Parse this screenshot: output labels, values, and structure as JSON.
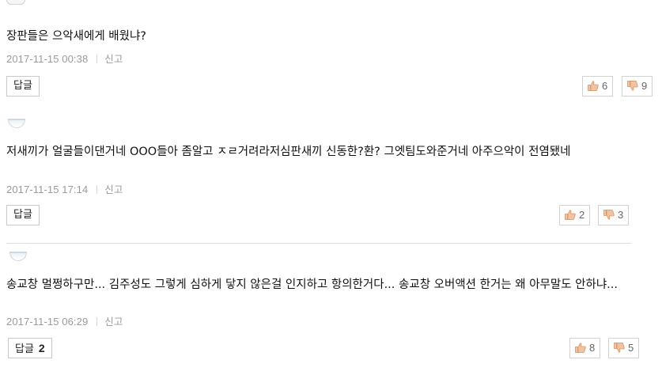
{
  "comments": [
    {
      "text": "장판들은 으악새에게 배웠냐?",
      "date": "2017-11-15 00:38",
      "report": "신고",
      "reply_label": "답글",
      "reply_count": "",
      "likes": "6",
      "dislikes": "9"
    },
    {
      "text": "저새끼가 얼굴들이댄거네 OOO들아 좀알고 ㅈㄹ거려라저심판새끼 신동한?환? 그엣팀도와준거네 아주으악이 전염됐네",
      "date": "2017-11-15 17:14",
      "report": "신고",
      "reply_label": "답글",
      "reply_count": "",
      "likes": "2",
      "dislikes": "3"
    },
    {
      "text": "송교창 멀쩡하구만... 김주성도 그렇게 심하게 닿지 않은걸 인지하고 항의한거다... 송교창 오버액션 한거는 왜 아무말도 안하냐...",
      "date": "2017-11-15 06:29",
      "report": "신고",
      "reply_label": "답글",
      "reply_count": "2",
      "likes": "8",
      "dislikes": "5"
    }
  ],
  "icons": {
    "like": "thumbs-up-icon",
    "dislike": "thumbs-down-icon",
    "avatar": "avatar-badge-icon"
  },
  "colors": {
    "like": "#e2a57a",
    "dislike": "#e2a57a",
    "meta": "#9a9a9a",
    "border": "#c9c9c9"
  }
}
